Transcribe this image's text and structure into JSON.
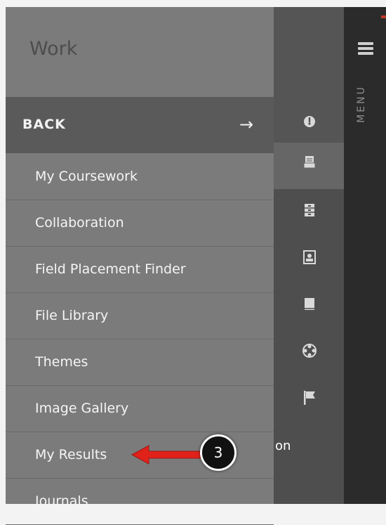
{
  "panel": {
    "title": "Work",
    "back_label": "BACK",
    "items": [
      {
        "label": "My Coursework"
      },
      {
        "label": "Collaboration"
      },
      {
        "label": "Field Placement Finder"
      },
      {
        "label": "File Library"
      },
      {
        "label": "Themes"
      },
      {
        "label": "Image Gallery"
      },
      {
        "label": "My Results"
      },
      {
        "label": "Journals"
      }
    ]
  },
  "menu_bar": {
    "label": "MENU"
  },
  "icon_column": {
    "icons": [
      "dashboard-icon",
      "coursework-tray-icon",
      "file-cabinet-icon",
      "portfolio-icon",
      "book-icon",
      "community-icon",
      "flag-icon"
    ],
    "partial_text": "on"
  },
  "annotation": {
    "step_number": "3",
    "color": "#e0221b"
  }
}
